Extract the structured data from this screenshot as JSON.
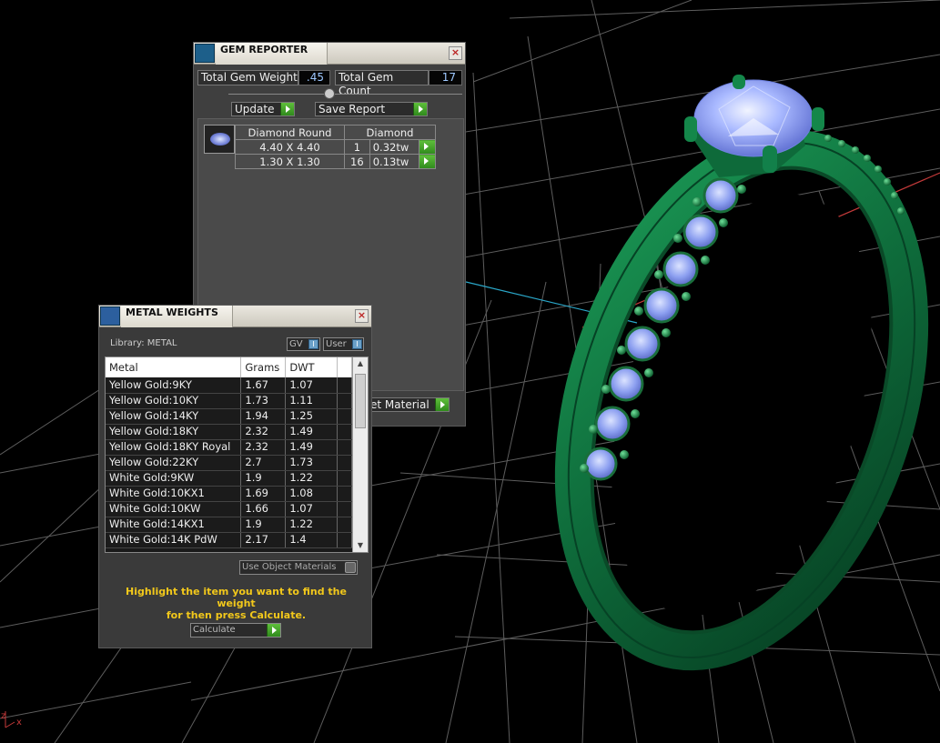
{
  "gem_reporter": {
    "title": "GEM REPORTER",
    "close_glyph": "×",
    "total_weight_label": "Total Gem Weight",
    "total_weight_value": ".45",
    "total_count_label": "Total Gem Count",
    "total_count_value": "17",
    "update_label": "Update",
    "save_report_label": "Save Report",
    "set_material_label": "et Material",
    "gem_shape_header": "Diamond Round",
    "gem_material_header": "Diamond",
    "rows": [
      {
        "size": "4.40 X 4.40",
        "count": "1",
        "weight": "0.32tw"
      },
      {
        "size": "1.30 X 1.30",
        "count": "16",
        "weight": "0.13tw"
      }
    ]
  },
  "metal_weights": {
    "title": "METAL WEIGHTS",
    "close_glyph": "×",
    "library_label": "Library: METAL",
    "gv_label": "GV",
    "user_label": "User",
    "toggle_glyph": "I",
    "columns": [
      "Metal",
      "Grams",
      "DWT"
    ],
    "rows": [
      {
        "metal": "Yellow Gold:9KY",
        "grams": "1.67",
        "dwt": "1.07"
      },
      {
        "metal": "Yellow Gold:10KY",
        "grams": "1.73",
        "dwt": "1.11"
      },
      {
        "metal": "Yellow Gold:14KY",
        "grams": "1.94",
        "dwt": "1.25"
      },
      {
        "metal": "Yellow Gold:18KY",
        "grams": "2.32",
        "dwt": "1.49"
      },
      {
        "metal": "Yellow Gold:18KY Royal",
        "grams": "2.32",
        "dwt": "1.49"
      },
      {
        "metal": "Yellow Gold:22KY",
        "grams": "2.7",
        "dwt": "1.73"
      },
      {
        "metal": "White Gold:9KW",
        "grams": "1.9",
        "dwt": "1.22"
      },
      {
        "metal": "White Gold:10KX1",
        "grams": "1.69",
        "dwt": "1.08"
      },
      {
        "metal": "White Gold:10KW",
        "grams": "1.66",
        "dwt": "1.07"
      },
      {
        "metal": "White Gold:14KX1",
        "grams": "1.9",
        "dwt": "1.22"
      },
      {
        "metal": "White Gold:14K PdW",
        "grams": "2.17",
        "dwt": "1.4"
      }
    ],
    "scroll_up_glyph": "▲",
    "scroll_down_glyph": "▼",
    "use_object_materials_label": "Use Object Materials",
    "hint_line1": "Highlight the item you want to find the weight",
    "hint_line2": "for then press Calculate.",
    "calculate_label": "Calculate"
  },
  "viewport": {
    "axis_x_label": "x",
    "axis_z_label": "z",
    "colors": {
      "ring_metal": "#0f6b3a",
      "gem": "#9fb4ff",
      "grid": "#8a8a8a",
      "x_axis": "#c43a3a",
      "y_axis": "#2aa7c9"
    }
  }
}
